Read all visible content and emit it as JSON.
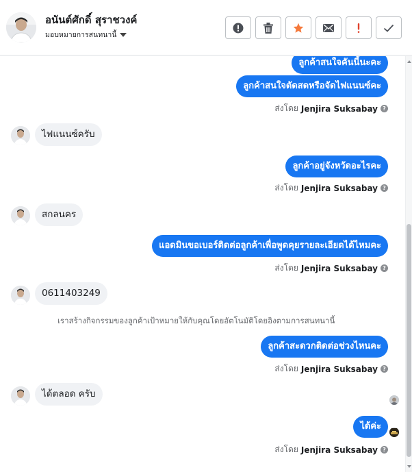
{
  "header": {
    "contact_name": "อนันต์ศักดิ์ สุราชวงค์",
    "assign_label": "มอบหมายการสนทนานี้",
    "actions": [
      {
        "name": "spam-icon",
        "label": "!"
      },
      {
        "name": "trash-icon",
        "label": "delete"
      },
      {
        "name": "star-icon",
        "label": "star"
      },
      {
        "name": "mail-icon",
        "label": "unread"
      },
      {
        "name": "important-icon",
        "label": "!"
      },
      {
        "name": "checkmark-icon",
        "label": "done"
      }
    ],
    "colors": {
      "star": "#f5793b",
      "important": "#e0432d",
      "icon": "#4b4f56"
    }
  },
  "conversation": {
    "messages": [
      {
        "dir": "out",
        "text": "ลูกค้าสนใจคันนี้นะคะ"
      },
      {
        "dir": "out",
        "text": "ลูกค้าสนใจตัดสดหรือจัดไฟแนนซ์คะ"
      },
      {
        "dir": "sent_by",
        "prefix": "ส่งโดย",
        "agent": "Jenjira Suksabay"
      },
      {
        "dir": "in",
        "text": "ไฟแนนซ์ครับ"
      },
      {
        "dir": "out",
        "text": "ลูกค้าอยู่จังหวัดอะไรคะ"
      },
      {
        "dir": "sent_by",
        "prefix": "ส่งโดย",
        "agent": "Jenjira Suksabay"
      },
      {
        "dir": "in",
        "text": "สกลนคร"
      },
      {
        "dir": "out",
        "text": "แอดมินขอเบอร์ติดต่อลูกค้าเพื่อพูดคุยรายละเอียดได้ไหมคะ"
      },
      {
        "dir": "sent_by",
        "prefix": "ส่งโดย",
        "agent": "Jenjira Suksabay"
      },
      {
        "dir": "in",
        "text": "0611403249"
      },
      {
        "dir": "note",
        "text": "เราสร้างกิจกรรมของลูกค้าเป้าหมายให้กับคุณโดยอัตโนมัติโดยอิงตามการสนทนานี้"
      },
      {
        "dir": "out",
        "text": "ลูกค้าสะดวกติดต่อช่วงไหนคะ"
      },
      {
        "dir": "sent_by",
        "prefix": "ส่งโดย",
        "agent": "Jenjira Suksabay"
      },
      {
        "dir": "in",
        "text": "ได้ตลอด ครับ"
      },
      {
        "dir": "out",
        "text": "ได้ค่ะ"
      },
      {
        "dir": "sent_by",
        "prefix": "ส่งโดย",
        "agent": "Jenjira Suksabay"
      }
    ],
    "colors": {
      "outgoing": "#1877f2",
      "incoming": "#f0f2f5"
    }
  }
}
